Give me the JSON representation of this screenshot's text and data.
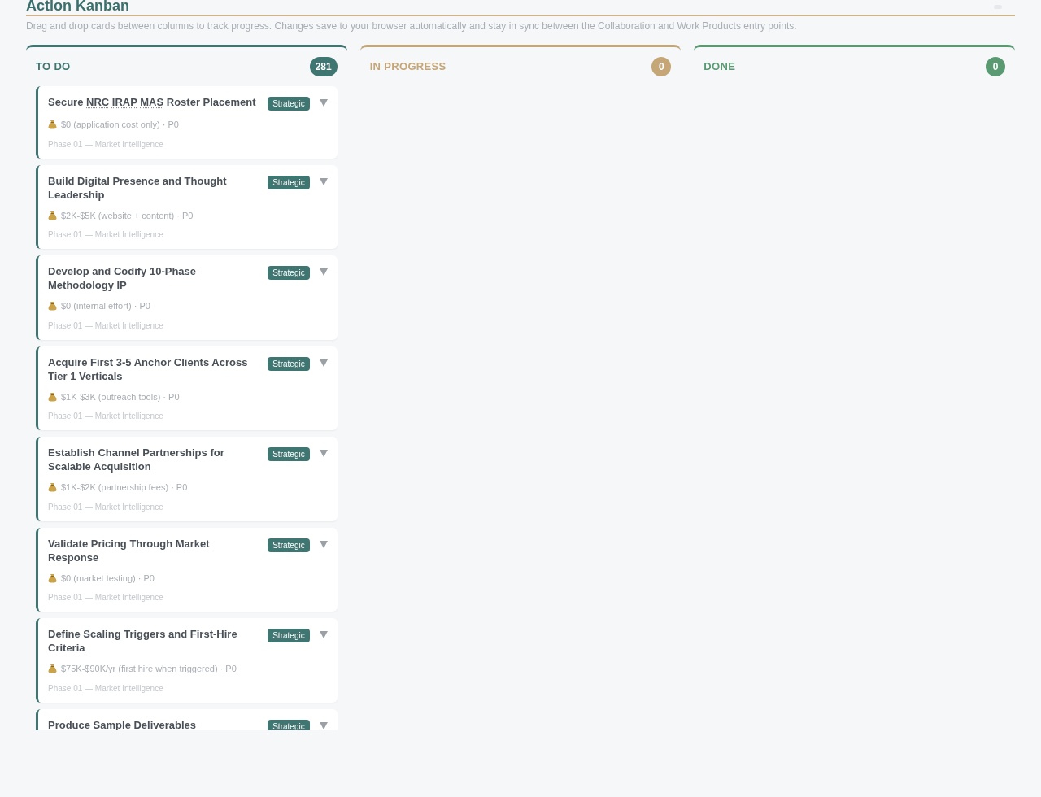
{
  "title": "Action Kanban",
  "subtitle": "Drag and drop cards between columns to track progress. Changes save to your browser automatically and stay in sync between the Collaboration and Work Products entry points.",
  "columns": [
    {
      "name": "TO DO",
      "count": "281",
      "color": "#3f7672",
      "cards": [
        {
          "title_parts": [
            {
              "text": "Secure",
              "abbr": false
            },
            {
              "text": "NRC",
              "abbr": true
            },
            {
              "text": "IRAP",
              "abbr": true
            },
            {
              "text": "MAS",
              "abbr": true
            },
            {
              "text": "Roster Placement",
              "abbr": false
            }
          ],
          "tag": "Strategic",
          "meta": "$0 (application cost only) · P0",
          "phase": "Phase 01 — Market Intelligence"
        },
        {
          "title": "Build Digital Presence and Thought Leadership",
          "tag": "Strategic",
          "meta": "$2K-$5K (website + content) · P0",
          "phase": "Phase 01 — Market Intelligence"
        },
        {
          "title": "Develop and Codify 10-Phase Methodology IP",
          "tag": "Strategic",
          "meta": "$0 (internal effort) · P0",
          "phase": "Phase 01 — Market Intelligence"
        },
        {
          "title": "Acquire First 3-5 Anchor Clients Across Tier 1 Verticals",
          "tag": "Strategic",
          "meta": "$1K-$3K (outreach tools) · P0",
          "phase": "Phase 01 — Market Intelligence"
        },
        {
          "title": "Establish Channel Partnerships for Scalable Acquisition",
          "tag": "Strategic",
          "meta": "$1K-$2K (partnership fees) · P0",
          "phase": "Phase 01 — Market Intelligence"
        },
        {
          "title": "Validate Pricing Through Market Response",
          "tag": "Strategic",
          "meta": "$0 (market testing) · P0",
          "phase": "Phase 01 — Market Intelligence"
        },
        {
          "title": "Define Scaling Triggers and First-Hire Criteria",
          "tag": "Strategic",
          "meta": "$75K-$90K/yr (first hire when triggered) · P0",
          "phase": "Phase 01 — Market Intelligence"
        },
        {
          "title": "Produce Sample Deliverables",
          "tag": "Strategic"
        }
      ]
    },
    {
      "name": "IN PROGRESS",
      "count": "0",
      "color": "#c5a677"
    },
    {
      "name": "DONE",
      "count": "0",
      "color": "#5a9a72"
    }
  ]
}
